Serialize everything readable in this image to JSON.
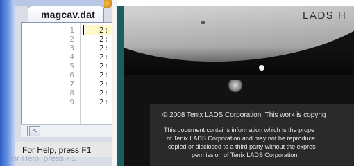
{
  "editor": {
    "tab_label": "magcav.dat",
    "lines": [
      {
        "num": "1",
        "text": "2:"
      },
      {
        "num": "2",
        "text": "2:"
      },
      {
        "num": "3",
        "text": "2:"
      },
      {
        "num": "4",
        "text": "2:"
      },
      {
        "num": "5",
        "text": "2:"
      },
      {
        "num": "6",
        "text": "2:"
      },
      {
        "num": "7",
        "text": "2:"
      },
      {
        "num": "8",
        "text": "2:"
      },
      {
        "num": "9",
        "text": "2:"
      }
    ],
    "scroll_left_glyph": "<",
    "status_text": "For Help, press F1",
    "status_ghost_text": "For Help, press F1"
  },
  "document_image": {
    "heading": "LADS H",
    "notice_lines": [
      "© 2008 Tenix LADS Corporation.  This work is copyrig",
      "This document contains information which is the prope",
      "of Tenix LADS Corporation and may not be reproduce",
      "copied or disclosed to a third party without the expres",
      "permission of Tenix LADS Corporation."
    ]
  },
  "colors": {
    "taskbar_blue": "#2f5fc4",
    "doc_background": "#121212",
    "doc_accent_teal": "#1b5e60"
  }
}
